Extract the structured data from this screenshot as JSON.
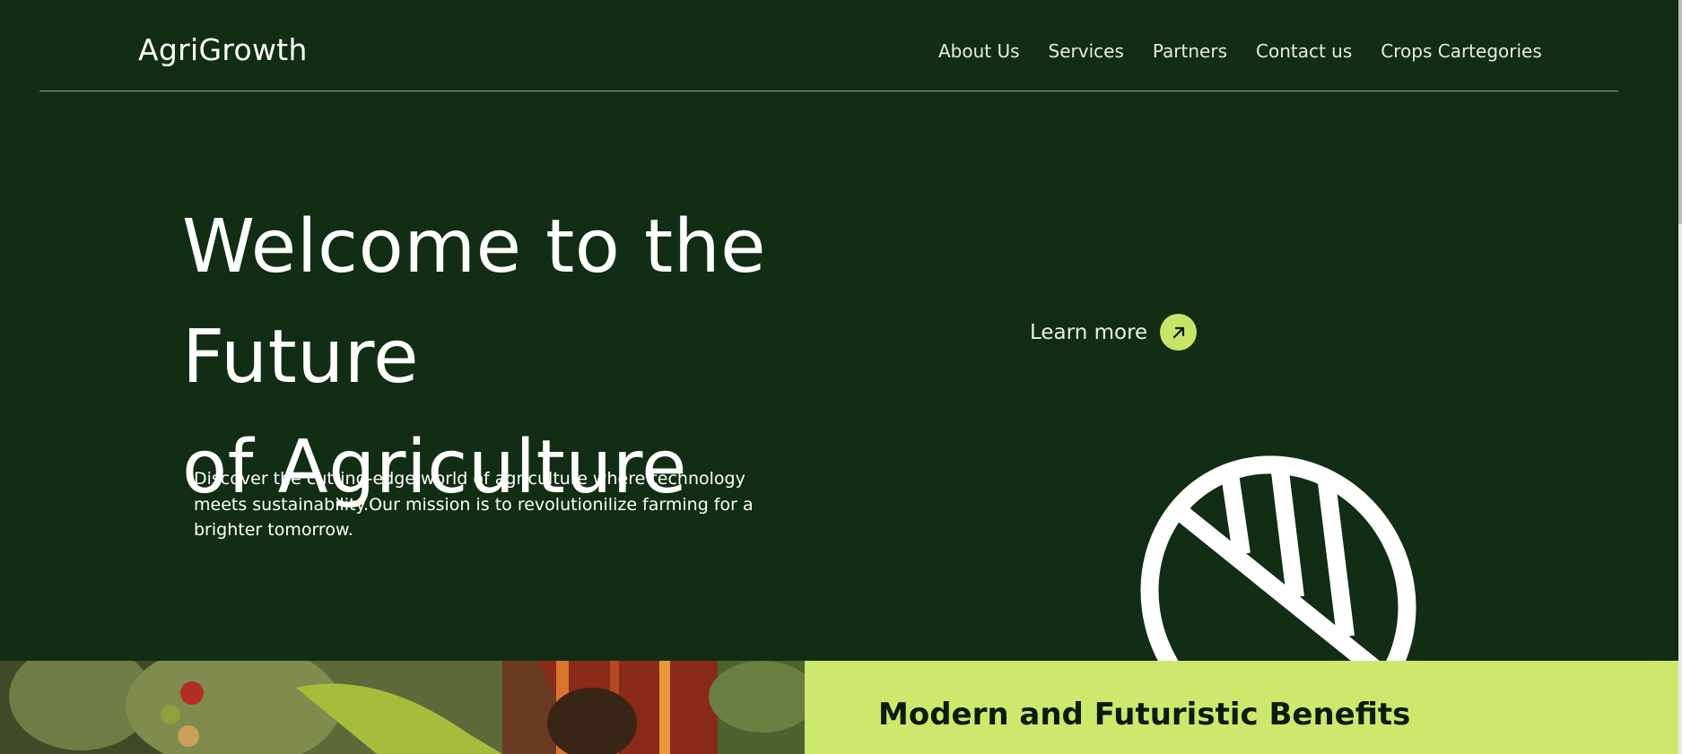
{
  "brand": {
    "name": "AgriGrowth"
  },
  "nav": {
    "items": [
      {
        "label": "About Us"
      },
      {
        "label": "Services"
      },
      {
        "label": "Partners"
      },
      {
        "label": "Contact us"
      },
      {
        "label": "Crops Cartegories"
      }
    ]
  },
  "hero": {
    "headline_line1": "Welcome to the Future",
    "headline_line2": "of Agriculture",
    "learn_more": "Learn more",
    "learn_more_icon": "arrow-up-right-icon",
    "intro_line1": "Discover the cutting-edge world of agriculture where technology",
    "intro_line2": "meets sustainability.Our mission is to revolutionilize farming for a",
    "intro_line3": "brighter tomorrow.",
    "leaf_icon": "leaf-logo-icon"
  },
  "benefits": {
    "title": "Modern and Futuristic Benefits"
  },
  "colors": {
    "hero_bg": "#112d14",
    "accent": "#c8e468",
    "benefits_bg": "#cde86c",
    "text_light": "#ffffff"
  }
}
